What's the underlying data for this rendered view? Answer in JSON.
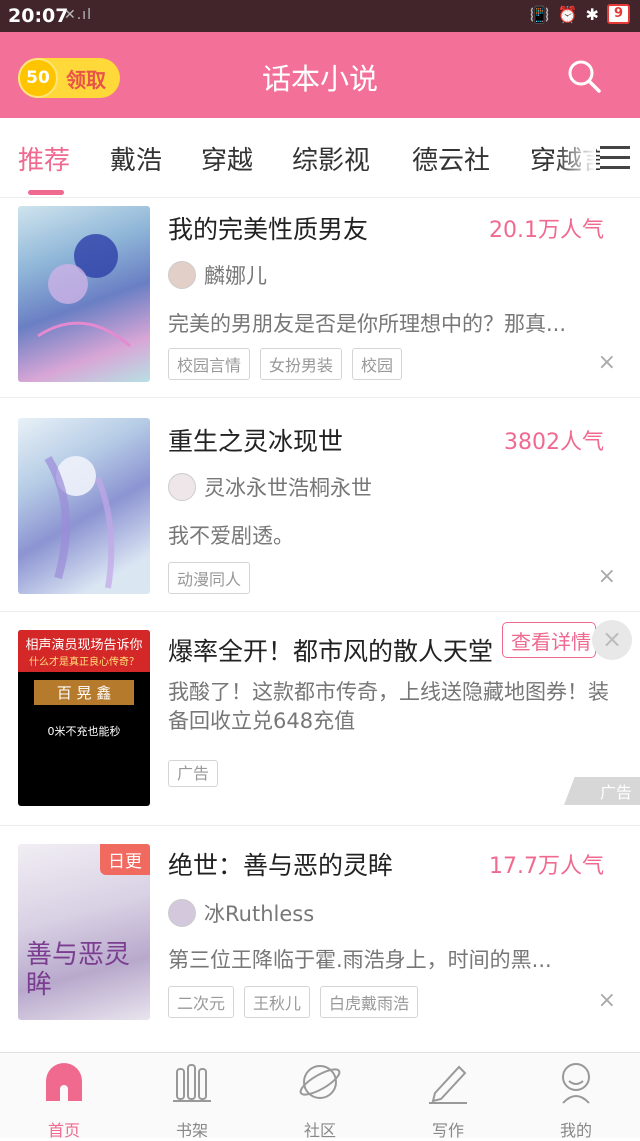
{
  "status_bar": {
    "time": "20:07",
    "signal": "✕.ıl",
    "battery": "9",
    "icons": [
      "vibrate-icon",
      "alarm-icon",
      "bluetooth-icon"
    ]
  },
  "header": {
    "coin_count": "50",
    "claim_label": "领取",
    "title": "话本小说",
    "search_icon": "search-icon"
  },
  "tabs": [
    {
      "label": "推荐",
      "active": true
    },
    {
      "label": "戴浩"
    },
    {
      "label": "穿越"
    },
    {
      "label": "综影视"
    },
    {
      "label": "德云社"
    },
    {
      "label": "穿越言"
    }
  ],
  "feed": [
    {
      "title": "我的完美性质男友",
      "popularity": "20.1万人气",
      "author": "麟娜儿",
      "description": "完美的男朋友是否是你所理想中的？那真...",
      "tags": [
        "校园言情",
        "女扮男装",
        "校园"
      ],
      "close": "×"
    },
    {
      "title": "重生之灵冰现世",
      "popularity": "3802人气",
      "author": "灵冰永世浩桐永世",
      "description": "我不爱剧透。",
      "tags": [
        "动漫同人"
      ],
      "close": "×"
    },
    {
      "type": "ad",
      "title": "爆率全开！都市风的散人天堂",
      "detail_button": "查看详情",
      "close": "×",
      "description": "我酸了！这款都市传奇，上线送隐藏地图券！装备回收立兑648充值",
      "tag": "广告",
      "ad_label": "广告",
      "cover_text": [
        "相声演员现场告诉你",
        "什么才是真正良心传奇？",
        "百 晃 鑫",
        "0米不充也能秒"
      ]
    },
    {
      "title": "绝世：善与恶的灵眸",
      "popularity": "17.7万人气",
      "author": "冰Ruthless",
      "description": "第三位王降临于霍.雨浩身上，时间的黑...",
      "tags": [
        "二次元",
        "王秋儿",
        "白虎戴雨浩"
      ],
      "badge": "日更",
      "cover_text": "善与恶灵眸",
      "close": "×"
    }
  ],
  "bottom_nav": [
    {
      "label": "首页",
      "icon": "home-icon",
      "active": true
    },
    {
      "label": "书架",
      "icon": "bookshelf-icon"
    },
    {
      "label": "社区",
      "icon": "community-planet-icon"
    },
    {
      "label": "写作",
      "icon": "pen-icon"
    },
    {
      "label": "我的",
      "icon": "profile-icon"
    }
  ],
  "colors": {
    "brand_pink": "#f37098",
    "accent_pink": "#f06a90",
    "status_bar": "#41252a"
  }
}
